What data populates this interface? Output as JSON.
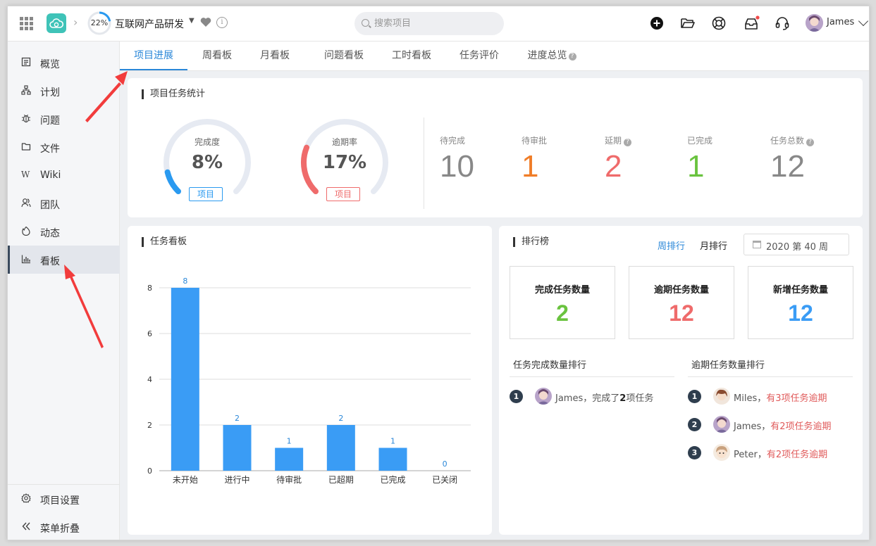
{
  "topbar": {
    "progress": {
      "percent": 22,
      "label": "22%"
    },
    "project_name": "互联网产品研发",
    "search_placeholder": "搜索项目",
    "user_name": "James"
  },
  "sidebar": {
    "items": [
      {
        "label": "概览",
        "icon": "overview-icon"
      },
      {
        "label": "计划",
        "icon": "plan-icon"
      },
      {
        "label": "问题",
        "icon": "bug-icon"
      },
      {
        "label": "文件",
        "icon": "folder-icon"
      },
      {
        "label": "Wiki",
        "icon": "wiki-icon"
      },
      {
        "label": "团队",
        "icon": "team-icon"
      },
      {
        "label": "动态",
        "icon": "activity-icon"
      },
      {
        "label": "看板",
        "icon": "board-icon",
        "active": true
      }
    ],
    "settings_label": "项目设置",
    "collapse_label": "菜单折叠"
  },
  "tabs": [
    {
      "label": "项目进展",
      "active": true
    },
    {
      "label": "周看板"
    },
    {
      "label": "月看板"
    },
    {
      "label": "问题看板"
    },
    {
      "label": "工时看板"
    },
    {
      "label": "任务评价"
    },
    {
      "label": "进度总览",
      "help": "?"
    }
  ],
  "stats_card": {
    "title": "项目任务统计",
    "gauges": [
      {
        "label": "完成度",
        "value": "8%",
        "percent": 8,
        "tag": "项目",
        "color": "#2a9af0"
      },
      {
        "label": "逾期率",
        "value": "17%",
        "percent": 17,
        "tag": "项目",
        "color": "#ef6b6b"
      }
    ],
    "stats": [
      {
        "label": "待完成",
        "value": "10",
        "color": "#888888"
      },
      {
        "label": "待审批",
        "value": "1",
        "color": "#f07d28"
      },
      {
        "label": "延期",
        "value": "2",
        "color": "#ef6b6b",
        "help": "?"
      },
      {
        "label": "已完成",
        "value": "1",
        "color": "#6ac33f"
      },
      {
        "label": "任务总数",
        "value": "12",
        "color": "#888888",
        "help": "?"
      }
    ]
  },
  "board_card": {
    "title": "任务看板"
  },
  "chart_data": {
    "type": "bar",
    "categories": [
      "未开始",
      "进行中",
      "待审批",
      "已超期",
      "已完成",
      "已关闭"
    ],
    "values": [
      8,
      2,
      1,
      2,
      1,
      0
    ],
    "y_ticks": [
      0,
      2,
      4,
      6,
      8
    ],
    "ylim": [
      0,
      8
    ],
    "bar_color": "#3a9cf5",
    "grid": true,
    "data_labels": true
  },
  "ranking_card": {
    "title": "排行榜",
    "tab_week": "周排行",
    "tab_month": "月排行",
    "date_value": "2020 第 40 周",
    "metrics": [
      {
        "label": "完成任务数量",
        "value": "2",
        "color": "#6ac33f"
      },
      {
        "label": "逾期任务数量",
        "value": "12",
        "color": "#ef6b6b"
      },
      {
        "label": "新增任务数量",
        "value": "12",
        "color": "#3a9cf5"
      }
    ],
    "completed_title": "任务完成数量排行",
    "completed": [
      {
        "rank": "1",
        "name": "James",
        "prefix": "，完成了",
        "count": "2",
        "suffix": "项任务"
      }
    ],
    "overdue_title": "逾期任务数量排行",
    "overdue": [
      {
        "rank": "1",
        "name": "Miles",
        "text": "有3项任务逾期"
      },
      {
        "rank": "2",
        "name": "James",
        "text": "有2项任务逾期"
      },
      {
        "rank": "3",
        "name": "Peter",
        "text": "有2项任务逾期"
      }
    ]
  }
}
